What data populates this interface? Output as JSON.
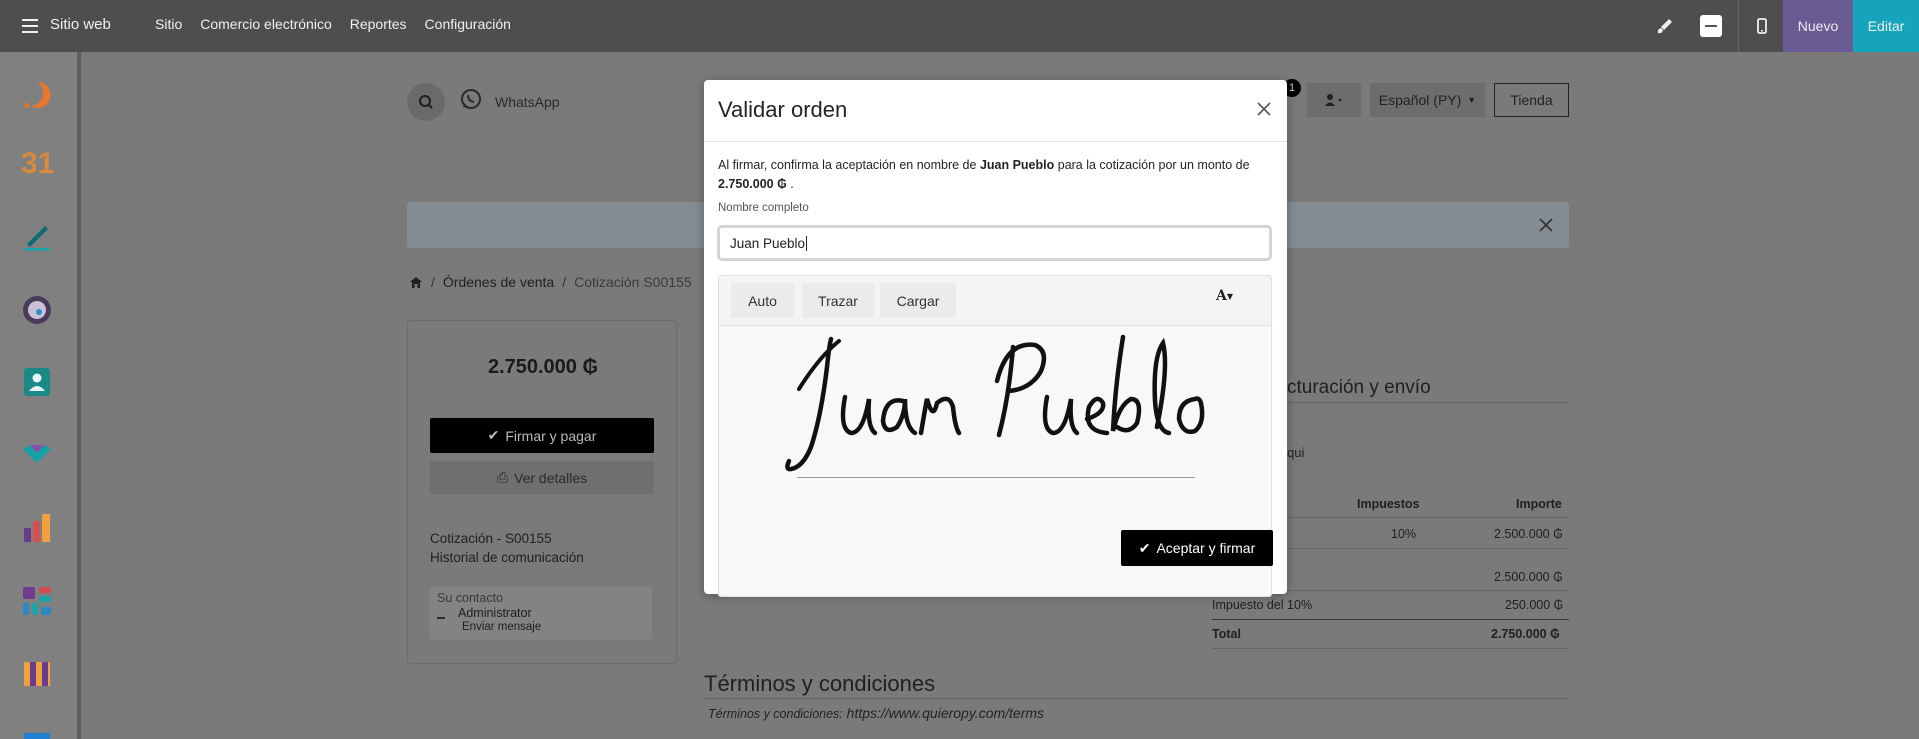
{
  "topbar": {
    "app_name": "Sitio web",
    "menu": [
      "Sitio",
      "Comercio electrónico",
      "Reportes",
      "Configuración"
    ],
    "new_label": "Nuevo",
    "edit_label": "Editar",
    "icons": [
      "hamburger-icon",
      "brush-icon",
      "mobile-icon"
    ]
  },
  "dock": {
    "apps": [
      "discuss-icon",
      "calendar-icon",
      "sign-icon",
      "website-icon",
      "contacts-icon",
      "crm-icon",
      "reports-icon",
      "apps-icon",
      "store-icon",
      "windows-icon"
    ],
    "calendar_number": "31"
  },
  "background": {
    "whatsapp": "WhatsApp",
    "cart_badge": "1",
    "language": "Español (PY)",
    "store_label": "Tienda",
    "breadcrumb": [
      "Órdenes de venta",
      "Cotización S00155"
    ],
    "total": "2.750.000 ₲",
    "sign_pay": "Firmar y pagar",
    "view_details": "Ver detalles",
    "quote_ref": "Cotización - S00155",
    "history": "Historial de comunicación",
    "contact_label": "Su contacto",
    "contact_name": "Administrator",
    "send_message": "Enviar mensaje",
    "billing_heading": "cturación y envío",
    "qui": "qui",
    "col_taxes": "Impuestos",
    "col_amount": "Importe",
    "row_tax": "10%",
    "row_amount": "2.500.000 ₲",
    "subtotal": "2.500.000 ₲",
    "tax_label": "Impuesto del 10%",
    "tax_amount": "250.000 ₲",
    "total_label": "Total",
    "total_amount": "2.750.000 ₲",
    "terms_heading": "Términos y condiciones",
    "terms_label": "Términos y condiciones:",
    "terms_url": "https://www.quieropy.com/terms"
  },
  "modal": {
    "title": "Validar orden",
    "text_before": "Al firmar, confirma la aceptación en nombre de ",
    "customer": "Juan Pueblo",
    "text_middle": " para la cotización por un monto de",
    "amount": "2.750.000 ₲",
    "text_after": " .",
    "field_label": "Nombre completo",
    "full_name": "Juan Pueblo",
    "tabs": [
      "Auto",
      "Trazar",
      "Cargar"
    ],
    "font_button": "A",
    "signature": "Juan Pueblo",
    "accept_label": "Aceptar y firmar"
  }
}
